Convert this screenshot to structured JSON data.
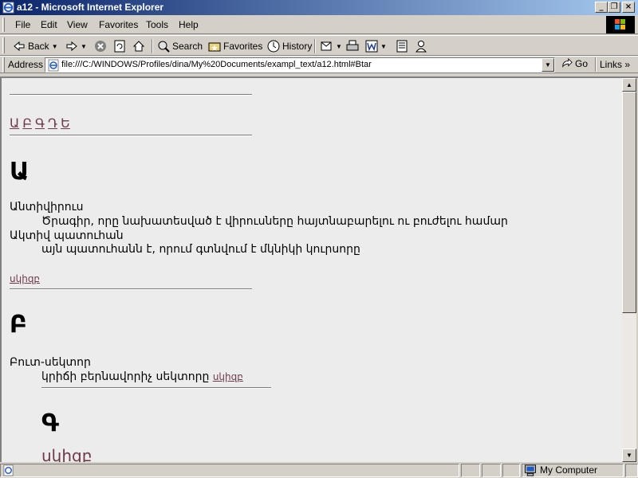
{
  "window": {
    "title": "a12 - Microsoft Internet Explorer",
    "minimize": "_",
    "restore": "❐",
    "close": "×"
  },
  "menu": {
    "items": [
      "File",
      "Edit",
      "View",
      "Favorites",
      "Tools",
      "Help"
    ]
  },
  "toolbar": {
    "back_label": "Back",
    "search_label": "Search",
    "favorites_label": "Favorites",
    "history_label": "History"
  },
  "address": {
    "label": "Address",
    "value": "file:///C:/WINDOWS/Profiles/dina/My%20Documents/exampl_text/a12.html#Btar",
    "go_label": "Go",
    "links_label": "Links »"
  },
  "content": {
    "alphabet": [
      "Ա",
      "Բ",
      "Գ",
      "Դ",
      "Ե"
    ],
    "section_a": {
      "letter": "Ա",
      "entries": [
        {
          "term": "Անտիվիրուս",
          "definition": "Ծրագիր, որը նախատեսված է վիրուսները հայտնաբարելու ու բուժելու համար"
        },
        {
          "term": "Ակտիվ պատուհան",
          "definition": "այն պատուհանն է, որում գտնվում է մկնիկի կուրսորը"
        }
      ],
      "top_link": "սկիզբ"
    },
    "section_b": {
      "letter": "Բ",
      "entries": [
        {
          "term": "Բուտ-սեկտոր",
          "definition": "կրիճի բերնավորիչ սեկտորը",
          "link": "սկիզբ"
        }
      ]
    },
    "section_c": {
      "letter": "Գ",
      "partial_link": "սկիզբ"
    }
  },
  "status": {
    "zone": "My Computer"
  },
  "colors": {
    "titlebar_start": "#0a246a",
    "titlebar_end": "#a6caf0",
    "chrome": "#d4d0c8",
    "visited_link": "#6e3a4a",
    "page_bg": "#ececec"
  }
}
